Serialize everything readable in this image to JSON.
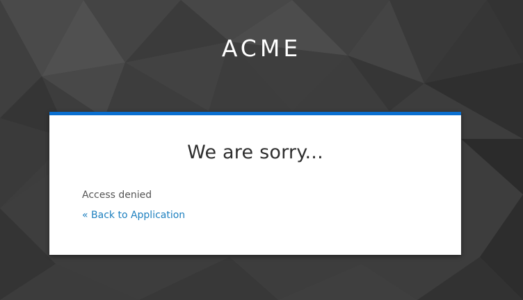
{
  "header": {
    "brand": "ACME"
  },
  "error_card": {
    "title": "We are sorry...",
    "message": "Access denied",
    "back_link": "« Back to Application"
  },
  "colors": {
    "background": "#3a3a3a",
    "card_accent": "#0a6fd0",
    "link": "#1c7fbf"
  }
}
